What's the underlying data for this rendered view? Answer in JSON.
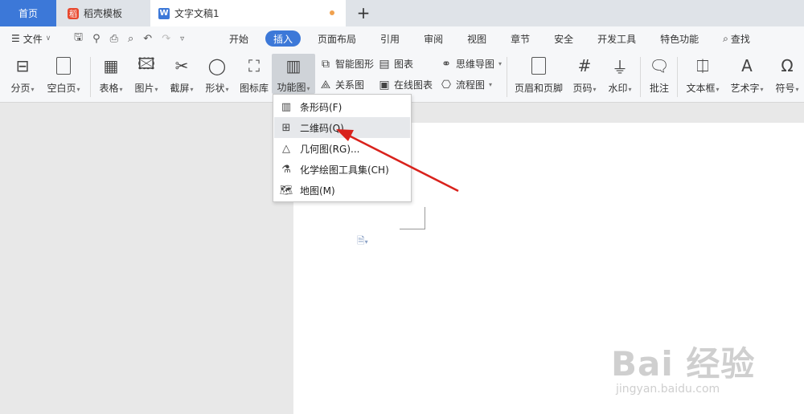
{
  "tabs": {
    "home": "首页",
    "templates": "稻壳模板",
    "document": "文字文稿1",
    "add": "+"
  },
  "menu": {
    "file": "文件",
    "tabs": [
      "开始",
      "插入",
      "页面布局",
      "引用",
      "审阅",
      "视图",
      "章节",
      "安全",
      "开发工具",
      "特色功能"
    ],
    "active_tab": "插入",
    "search": "查找"
  },
  "ribbon": {
    "page_break": "分页",
    "blank_page": "空白页",
    "table": "表格",
    "picture": "图片",
    "screenshot": "截屏",
    "shape": "形状",
    "icon_library": "图标库",
    "function_chart": "功能图",
    "smart_art": "智能图形",
    "chart": "图表",
    "relation_chart": "关系图",
    "online_chart": "在线图表",
    "mind_map": "思维导图",
    "flow_chart": "流程图",
    "header_footer": "页眉和页脚",
    "page_number": "页码",
    "watermark": "水印",
    "comment": "批注",
    "text_box": "文本框",
    "word_art": "艺术字",
    "symbol": "符号"
  },
  "dropdown": {
    "items": [
      "条形码(F)",
      "二维码(Q)",
      "几何图(RG)...",
      "化学绘图工具集(CH)",
      "地图(M)"
    ],
    "hovered": "二维码(Q)"
  },
  "watermark_text": {
    "main": "Bai 经验",
    "sub": "jingyan.baidu.com"
  },
  "colors": {
    "accent": "#3c78d8",
    "arrow": "#d9221c"
  }
}
